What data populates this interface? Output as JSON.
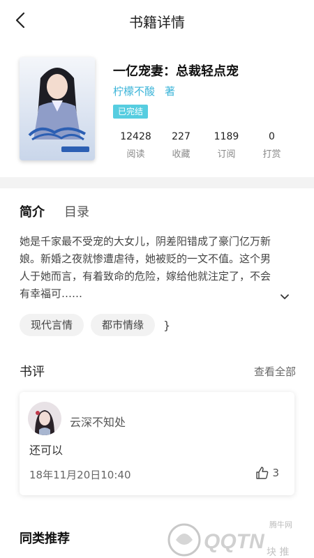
{
  "header": {
    "title": "书籍详情"
  },
  "book": {
    "title": "一亿宠妻：总裁轻点宠",
    "author": "柠檬不酸",
    "author_suffix": "著",
    "status": "已完结",
    "stats": [
      {
        "value": "12428",
        "label": "阅读"
      },
      {
        "value": "227",
        "label": "收藏"
      },
      {
        "value": "1189",
        "label": "订阅"
      },
      {
        "value": "0",
        "label": "打赏"
      }
    ]
  },
  "tabs": [
    {
      "label": "简介"
    },
    {
      "label": "目录"
    }
  ],
  "intro": {
    "text": "她是千家最不受宠的大女儿，阴差阳错成了豪门亿万新娘。新婚之夜就惨遭虐待，她被贬的一文不值。这个男人于她而言，有着致命的危险，嫁给他就注定了，不会有幸福可……"
  },
  "tags": [
    {
      "label": "现代言情"
    },
    {
      "label": "都市情缘"
    }
  ],
  "tags_trailing": "}",
  "reviews": {
    "title": "书评",
    "view_all": "查看全部",
    "items": [
      {
        "user": "云深不知处",
        "text": "还可以",
        "time": "18年11月20日10:40",
        "likes": "3"
      }
    ]
  },
  "similar": {
    "title": "同类推荐"
  },
  "watermark": {
    "site": "腾牛网",
    "brand": "QQTN",
    "cn": "块  推"
  },
  "colors": {
    "accent": "#3bb4d8",
    "badge": "#56cde0",
    "band": "#f3f3f3"
  }
}
